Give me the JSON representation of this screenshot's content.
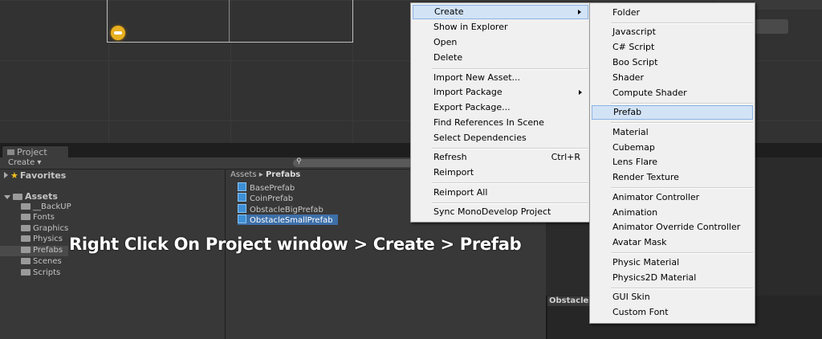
{
  "caption": "Right Click On Project window > Create > Prefab",
  "project_panel": {
    "tab_label": "Project",
    "create_label": "Create ▾",
    "search_glyph": "⚲",
    "breadcrumb": {
      "root": "Assets",
      "separator": "▸",
      "current": "Prefabs"
    },
    "tree": {
      "favorites": "Favorites",
      "assets": "Assets",
      "folders": [
        "__BackUP",
        "Fonts",
        "Graphics",
        "Physics",
        "Prefabs",
        "Scenes",
        "Scripts"
      ],
      "selected_folder": "Prefabs"
    },
    "assets": [
      "BasePrefab",
      "CoinPrefab",
      "ObstacleBigPrefab",
      "ObstacleSmallPrefab"
    ],
    "selected_asset": "ObstacleSmallPrefab"
  },
  "bottom_right_header": "Obstacle",
  "context_menu": {
    "items": [
      {
        "label": "Create",
        "submenu": true,
        "highlighted": true
      },
      {
        "label": "Show in Explorer"
      },
      {
        "label": "Open"
      },
      {
        "label": "Delete"
      },
      {
        "label": "Import New Asset..."
      },
      {
        "label": "Import Package",
        "submenu": true
      },
      {
        "label": "Export Package..."
      },
      {
        "label": "Find References In Scene"
      },
      {
        "label": "Select Dependencies"
      },
      {
        "label": "Refresh",
        "shortcut": "Ctrl+R"
      },
      {
        "label": "Reimport"
      },
      {
        "label": "Reimport All"
      },
      {
        "label": "Sync MonoDevelop Project"
      }
    ]
  },
  "create_submenu": {
    "items": [
      "Folder",
      "Javascript",
      "C# Script",
      "Boo Script",
      "Shader",
      "Compute Shader",
      "Prefab",
      "Material",
      "Cubemap",
      "Lens Flare",
      "Render Texture",
      "Animator Controller",
      "Animation",
      "Animator Override Controller",
      "Avatar Mask",
      "Physic Material",
      "Physics2D Material",
      "GUI Skin",
      "Custom Font"
    ],
    "highlighted": "Prefab"
  },
  "colors": {
    "selection_blue": "#3d6fa8",
    "menu_highlight": "#d2e3f6",
    "menu_bg": "#f0f0f0"
  }
}
